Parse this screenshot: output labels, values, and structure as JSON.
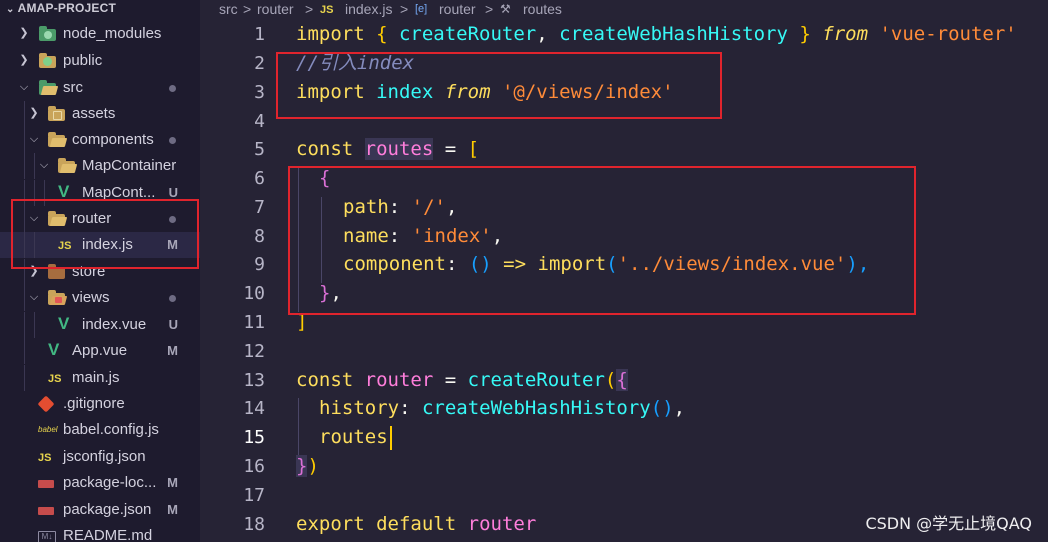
{
  "explorer": {
    "project_title": "AMAP-PROJECT",
    "items": [
      {
        "label": "node_modules",
        "badge": ""
      },
      {
        "label": "public",
        "badge": ""
      },
      {
        "label": "src",
        "badge": "dot"
      },
      {
        "label": "assets",
        "badge": ""
      },
      {
        "label": "components",
        "badge": "dot"
      },
      {
        "label": "MapContainer",
        "badge": ""
      },
      {
        "label": "MapCont...",
        "badge": "U"
      },
      {
        "label": "router",
        "badge": "dot"
      },
      {
        "label": "index.js",
        "badge": "M"
      },
      {
        "label": "store",
        "badge": ""
      },
      {
        "label": "views",
        "badge": "dot"
      },
      {
        "label": "index.vue",
        "badge": "U"
      },
      {
        "label": "App.vue",
        "badge": "M"
      },
      {
        "label": "main.js",
        "badge": ""
      },
      {
        "label": ".gitignore",
        "badge": ""
      },
      {
        "label": "babel.config.js",
        "badge": ""
      },
      {
        "label": "jsconfig.json",
        "badge": ""
      },
      {
        "label": "package-loc...",
        "badge": "M"
      },
      {
        "label": "package.json",
        "badge": "M"
      },
      {
        "label": "README.md",
        "badge": ""
      }
    ],
    "js_icon_text": "JS",
    "vue_icon_text": "V",
    "md_icon_text": "M↓",
    "babel_icon_text": "babel"
  },
  "breadcrumb": {
    "part1": "src",
    "sep1": ">",
    "part2": "router",
    "sep2": ">",
    "file_icon": "JS",
    "part3": "index.js",
    "sep3": ">",
    "symbol_icon": "[e]",
    "part4": "router",
    "sep4": ">",
    "prop_icon": "🔧",
    "part5": "routes"
  },
  "line_numbers": [
    "1",
    "2",
    "3",
    "4",
    "5",
    "6",
    "7",
    "8",
    "9",
    "10",
    "11",
    "12",
    "13",
    "14",
    "15",
    "16",
    "17",
    "18"
  ],
  "code": {
    "l1": {
      "a": "import",
      "b": " { ",
      "c": "createRouter",
      "d": ", ",
      "e": "createWebHashHistory",
      "f": " } ",
      "g": "from",
      "h": " ",
      "i": "'vue-router'"
    },
    "l2": {
      "a": "//引入index"
    },
    "l3": {
      "a": "import",
      "b": " ",
      "c": "index",
      "d": " ",
      "e": "from",
      "f": " ",
      "g": "'@/views/index'"
    },
    "l5": {
      "a": "const",
      "b": " ",
      "c": "routes",
      "d": " = ",
      "e": "["
    },
    "l6": {
      "a": "{"
    },
    "l7": {
      "a": "path",
      ":": ": ",
      "b": "'/'",
      "c": ","
    },
    "l8": {
      "a": "name",
      ":": ": ",
      "b": "'index'",
      "c": ","
    },
    "l9": {
      "a": "component",
      ":": ": ",
      "b": "()",
      "c": " => ",
      "d": "import",
      "e": "(",
      "f": "'../views/index.vue'",
      "g": "),"
    },
    "l10": {
      "a": "}",
      "b": ","
    },
    "l11": {
      "a": "]"
    },
    "l13": {
      "a": "const",
      "b": " ",
      "c": "router",
      "d": " = ",
      "e": "createRouter",
      "f": "(",
      "g": "{"
    },
    "l14": {
      "a": "history",
      ":": ": ",
      "b": "createWebHashHistory",
      "c": "()",
      "d": ","
    },
    "l15": {
      "a": "routes"
    },
    "l16": {
      "a": "}",
      "b": ")"
    },
    "l18": {
      "a": "export",
      "b": " ",
      "c": "default",
      "d": " ",
      "e": "router"
    }
  },
  "watermark": "CSDN @学无止境QAQ",
  "colors": {
    "background": "#262335",
    "sidebar": "#1e1b2e",
    "highlight_box": "#e0242d",
    "keyword": "#fede5d",
    "function": "#36f9f6",
    "string": "#ff8b39",
    "variable": "#ff7edb"
  }
}
